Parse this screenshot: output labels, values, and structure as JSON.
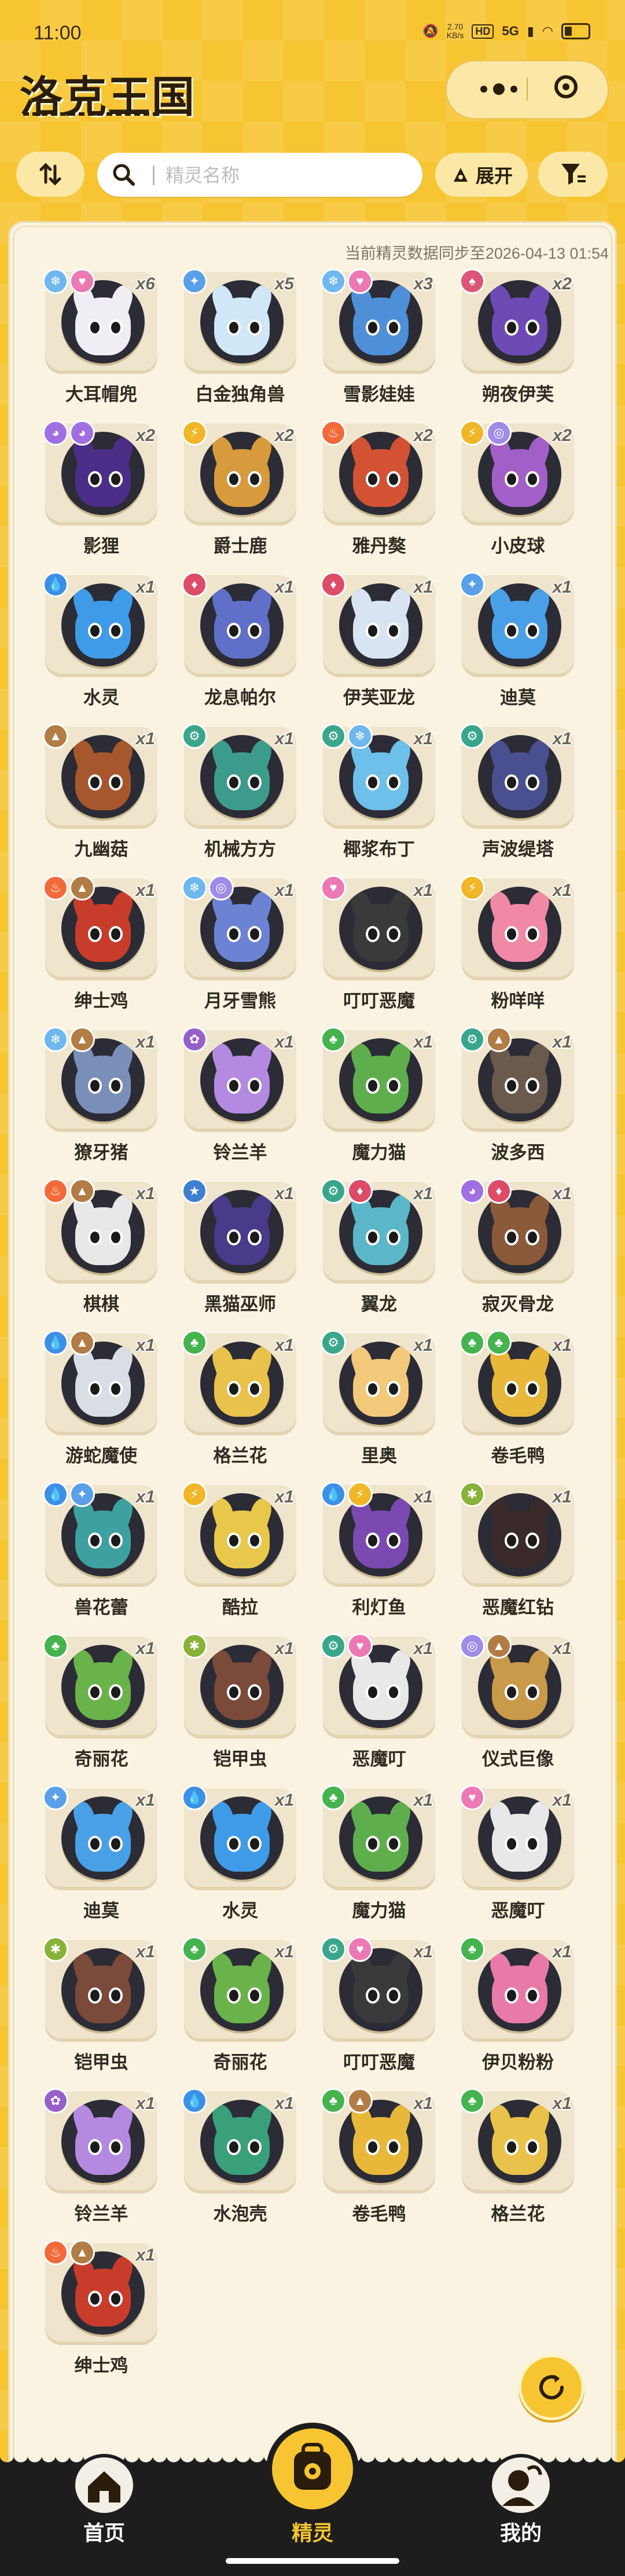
{
  "status_bar": {
    "time": "11:00",
    "net_speed": "2.70",
    "net_unit": "KB/s",
    "hd": "HD",
    "signal": "5G",
    "battery": "41"
  },
  "app": {
    "title": "洛克王国"
  },
  "toolbar": {
    "sort_icon": "sort-icon",
    "search_placeholder": "精灵名称",
    "expand_label": "展开",
    "filter_icon": "filter-icon"
  },
  "sync_text": "当前精灵数据同步至2026-04-13 01:54",
  "type_colors": {
    "ice": "#6fb8ef",
    "fairy": "#ec78b4",
    "light": "#5aa0e8",
    "ghost": "#a070e2",
    "electric": "#f1b628",
    "fire": "#f36a3a",
    "wind": "#a08be6",
    "water": "#3d8fe6",
    "dragon": "#dd4b66",
    "earth": "#b27c45",
    "mech": "#39a68a",
    "grass": "#45b34e",
    "poison": "#9760c8",
    "dark": "#3f7fd0",
    "bug": "#88b238",
    "evil": "#dd5577"
  },
  "pets": [
    {
      "name": "大耳帽兜",
      "count": "x6",
      "types": [
        "ice",
        "fairy"
      ],
      "color": "#f0eef4"
    },
    {
      "name": "白金独角兽",
      "count": "x5",
      "types": [
        "light"
      ],
      "color": "#cfe7f6"
    },
    {
      "name": "雪影娃娃",
      "count": "x3",
      "types": [
        "ice",
        "fairy"
      ],
      "color": "#4f8fd8"
    },
    {
      "name": "朔夜伊芙",
      "count": "x2",
      "types": [
        "evil"
      ],
      "color": "#6c4bb4"
    },
    {
      "name": "影狸",
      "count": "x2",
      "types": [
        "ghost",
        "ghost"
      ],
      "color": "#4b2e88"
    },
    {
      "name": "爵士鹿",
      "count": "x2",
      "types": [
        "electric"
      ],
      "color": "#d79a3c"
    },
    {
      "name": "雅丹獒",
      "count": "x2",
      "types": [
        "fire"
      ],
      "color": "#d25233"
    },
    {
      "name": "小皮球",
      "count": "x2",
      "types": [
        "electric",
        "wind"
      ],
      "color": "#a35fc8"
    },
    {
      "name": "水灵",
      "count": "x1",
      "types": [
        "water"
      ],
      "color": "#3f9be8"
    },
    {
      "name": "龙息帕尔",
      "count": "x1",
      "types": [
        "dragon"
      ],
      "color": "#6070c8"
    },
    {
      "name": "伊芙亚龙",
      "count": "x1",
      "types": [
        "dragon"
      ],
      "color": "#d9e4f2"
    },
    {
      "name": "迪莫",
      "count": "x1",
      "types": [
        "light"
      ],
      "color": "#4aa0e6"
    },
    {
      "name": "九幽菇",
      "count": "x1",
      "types": [
        "earth"
      ],
      "color": "#a7572e"
    },
    {
      "name": "机械方方",
      "count": "x1",
      "types": [
        "mech"
      ],
      "color": "#3d9b8c"
    },
    {
      "name": "椰浆布丁",
      "count": "x1",
      "types": [
        "mech",
        "ice"
      ],
      "color": "#6ec0ea"
    },
    {
      "name": "声波缇塔",
      "count": "x1",
      "types": [
        "mech"
      ],
      "color": "#4a4f8f"
    },
    {
      "name": "绅士鸡",
      "count": "x1",
      "types": [
        "fire",
        "earth"
      ],
      "color": "#c83c2c"
    },
    {
      "name": "月牙雪熊",
      "count": "x1",
      "types": [
        "ice",
        "wind"
      ],
      "color": "#6b83d2"
    },
    {
      "name": "叮叮恶魔",
      "count": "x1",
      "types": [
        "fairy"
      ],
      "color": "#3a3a3a"
    },
    {
      "name": "粉咩咩",
      "count": "x1",
      "types": [
        "electric"
      ],
      "color": "#f089a6"
    },
    {
      "name": "獠牙猪",
      "count": "x1",
      "types": [
        "ice",
        "earth"
      ],
      "color": "#7a8fb8"
    },
    {
      "name": "铃兰羊",
      "count": "x1",
      "types": [
        "poison"
      ],
      "color": "#b48ae0"
    },
    {
      "name": "魔力猫",
      "count": "x1",
      "types": [
        "grass"
      ],
      "color": "#5fae4d"
    },
    {
      "name": "波多西",
      "count": "x1",
      "types": [
        "mech",
        "earth"
      ],
      "color": "#6a5a4d"
    },
    {
      "name": "棋棋",
      "count": "x1",
      "types": [
        "fire",
        "earth"
      ],
      "color": "#e8e8e8"
    },
    {
      "name": "黑猫巫师",
      "count": "x1",
      "types": [
        "dark"
      ],
      "color": "#4a3a8a"
    },
    {
      "name": "翼龙",
      "count": "x1",
      "types": [
        "mech",
        "dragon"
      ],
      "color": "#5bb7c8"
    },
    {
      "name": "寂灭骨龙",
      "count": "x1",
      "types": [
        "ghost",
        "dragon"
      ],
      "color": "#8a5a3a"
    },
    {
      "name": "游蛇魔使",
      "count": "x1",
      "types": [
        "water",
        "earth"
      ],
      "color": "#d8dde6"
    },
    {
      "name": "格兰花",
      "count": "x1",
      "types": [
        "grass"
      ],
      "color": "#e8c24a"
    },
    {
      "name": "里奥",
      "count": "x1",
      "types": [
        "mech"
      ],
      "color": "#f2c87a"
    },
    {
      "name": "卷毛鸭",
      "count": "x1",
      "types": [
        "grass",
        "grass"
      ],
      "color": "#e8b83a"
    },
    {
      "name": "兽花蕾",
      "count": "x1",
      "types": [
        "water",
        "light"
      ],
      "color": "#3fa0a0"
    },
    {
      "name": "酷拉",
      "count": "x1",
      "types": [
        "electric"
      ],
      "color": "#e8c84a"
    },
    {
      "name": "利灯鱼",
      "count": "x1",
      "types": [
        "water",
        "electric"
      ],
      "color": "#7a4ab0"
    },
    {
      "name": "恶魔红钻",
      "count": "x1",
      "types": [
        "bug"
      ],
      "color": "#3a2a2a"
    },
    {
      "name": "奇丽花",
      "count": "x1",
      "types": [
        "grass"
      ],
      "color": "#6ab24a"
    },
    {
      "name": "铠甲虫",
      "count": "x1",
      "types": [
        "bug"
      ],
      "color": "#7a4a3a"
    },
    {
      "name": "恶魔叮",
      "count": "x1",
      "types": [
        "mech",
        "fairy"
      ],
      "color": "#e8e8e8"
    },
    {
      "name": "仪式巨像",
      "count": "x1",
      "types": [
        "wind",
        "earth"
      ],
      "color": "#c89a4a"
    },
    {
      "name": "迪莫",
      "count": "x1",
      "types": [
        "light"
      ],
      "color": "#4aa0e6"
    },
    {
      "name": "水灵",
      "count": "x1",
      "types": [
        "water"
      ],
      "color": "#3f9be8"
    },
    {
      "name": "魔力猫",
      "count": "x1",
      "types": [
        "grass"
      ],
      "color": "#5fae4d"
    },
    {
      "name": "恶魔叮",
      "count": "x1",
      "types": [
        "fairy"
      ],
      "color": "#e8e8e8"
    },
    {
      "name": "铠甲虫",
      "count": "x1",
      "types": [
        "bug"
      ],
      "color": "#7a4a3a"
    },
    {
      "name": "奇丽花",
      "count": "x1",
      "types": [
        "grass"
      ],
      "color": "#6ab24a"
    },
    {
      "name": "叮叮恶魔",
      "count": "x1",
      "types": [
        "mech",
        "fairy"
      ],
      "color": "#3a3a3a"
    },
    {
      "name": "伊贝粉粉",
      "count": "x1",
      "types": [
        "grass"
      ],
      "color": "#e87aa8"
    },
    {
      "name": "铃兰羊",
      "count": "x1",
      "types": [
        "poison"
      ],
      "color": "#b48ae0"
    },
    {
      "name": "水泡壳",
      "count": "x1",
      "types": [
        "water"
      ],
      "color": "#3aa07a"
    },
    {
      "name": "卷毛鸭",
      "count": "x1",
      "types": [
        "grass",
        "earth"
      ],
      "color": "#e8b83a"
    },
    {
      "name": "格兰花",
      "count": "x1",
      "types": [
        "grass"
      ],
      "color": "#e8c24a"
    },
    {
      "name": "绅士鸡",
      "count": "x1",
      "types": [
        "fire",
        "earth"
      ],
      "color": "#c83c2c"
    }
  ],
  "refresh_icon": "refresh-icon",
  "nav": [
    {
      "label": "首页",
      "icon": "home-icon",
      "active": false
    },
    {
      "label": "精灵",
      "icon": "backpack-icon",
      "active": true
    },
    {
      "label": "我的",
      "icon": "profile-icon",
      "active": false
    }
  ]
}
